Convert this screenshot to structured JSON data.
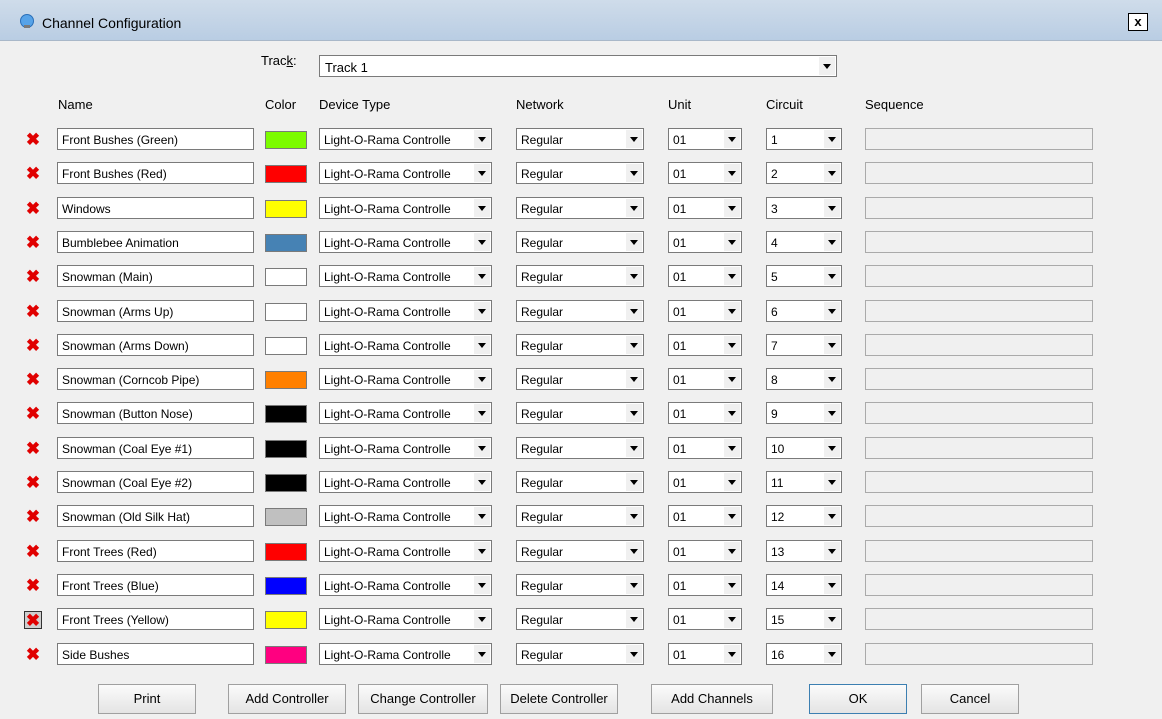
{
  "window": {
    "title": "Channel Configuration",
    "close_label": "x",
    "colors": {
      "title_bar": "#bfd2e7"
    }
  },
  "track": {
    "label": "Track:",
    "label_hotkey": "k",
    "value": "Track 1"
  },
  "columns": {
    "name": "Name",
    "color": "Color",
    "device_type": "Device Type",
    "network": "Network",
    "unit": "Unit",
    "circuit": "Circuit",
    "sequence": "Sequence"
  },
  "channels": [
    {
      "name": "Front Bushes (Green)",
      "color": "#7cfc00",
      "device": "Light-O-Rama Controlle",
      "network": "Regular",
      "unit": "01",
      "circuit": "1",
      "sequence": ""
    },
    {
      "name": "Front Bushes (Red)",
      "color": "#ff0000",
      "device": "Light-O-Rama Controlle",
      "network": "Regular",
      "unit": "01",
      "circuit": "2",
      "sequence": ""
    },
    {
      "name": "Windows",
      "color": "#ffff00",
      "device": "Light-O-Rama Controlle",
      "network": "Regular",
      "unit": "01",
      "circuit": "3",
      "sequence": ""
    },
    {
      "name": "Bumblebee Animation",
      "color": "#4682b4",
      "device": "Light-O-Rama Controlle",
      "network": "Regular",
      "unit": "01",
      "circuit": "4",
      "sequence": ""
    },
    {
      "name": "Snowman (Main)",
      "color": "#ffffff",
      "device": "Light-O-Rama Controlle",
      "network": "Regular",
      "unit": "01",
      "circuit": "5",
      "sequence": ""
    },
    {
      "name": "Snowman (Arms Up)",
      "color": "#ffffff",
      "device": "Light-O-Rama Controlle",
      "network": "Regular",
      "unit": "01",
      "circuit": "6",
      "sequence": ""
    },
    {
      "name": "Snowman (Arms Down)",
      "color": "#ffffff",
      "device": "Light-O-Rama Controlle",
      "network": "Regular",
      "unit": "01",
      "circuit": "7",
      "sequence": ""
    },
    {
      "name": "Snowman (Corncob Pipe)",
      "color": "#ff8000",
      "device": "Light-O-Rama Controlle",
      "network": "Regular",
      "unit": "01",
      "circuit": "8",
      "sequence": ""
    },
    {
      "name": "Snowman (Button Nose)",
      "color": "#000000",
      "device": "Light-O-Rama Controlle",
      "network": "Regular",
      "unit": "01",
      "circuit": "9",
      "sequence": ""
    },
    {
      "name": "Snowman (Coal Eye #1)",
      "color": "#000000",
      "device": "Light-O-Rama Controlle",
      "network": "Regular",
      "unit": "01",
      "circuit": "10",
      "sequence": ""
    },
    {
      "name": "Snowman (Coal Eye #2)",
      "color": "#000000",
      "device": "Light-O-Rama Controlle",
      "network": "Regular",
      "unit": "01",
      "circuit": "11",
      "sequence": ""
    },
    {
      "name": "Snowman (Old Silk Hat)",
      "color": "#c0c0c0",
      "device": "Light-O-Rama Controlle",
      "network": "Regular",
      "unit": "01",
      "circuit": "12",
      "sequence": ""
    },
    {
      "name": "Front Trees (Red)",
      "color": "#ff0000",
      "device": "Light-O-Rama Controlle",
      "network": "Regular",
      "unit": "01",
      "circuit": "13",
      "sequence": ""
    },
    {
      "name": "Front Trees (Blue)",
      "color": "#0000ff",
      "device": "Light-O-Rama Controlle",
      "network": "Regular",
      "unit": "01",
      "circuit": "14",
      "sequence": ""
    },
    {
      "name": "Front Trees (Yellow)",
      "color": "#ffff00",
      "device": "Light-O-Rama Controlle",
      "network": "Regular",
      "unit": "01",
      "circuit": "15",
      "sequence": ""
    },
    {
      "name": "Side Bushes",
      "color": "#ff0080",
      "device": "Light-O-Rama Controlle",
      "network": "Regular",
      "unit": "01",
      "circuit": "16",
      "sequence": ""
    }
  ],
  "delete_icon": {
    "glyph": "✖",
    "color": "#e00000",
    "selected_index": 14
  },
  "buttons": {
    "print": "Print",
    "add_controller": "Add Controller",
    "change_controller": "Change Controller",
    "delete_controller": "Delete Controller",
    "add_channels": "Add Channels",
    "ok": "OK",
    "cancel": "Cancel"
  }
}
